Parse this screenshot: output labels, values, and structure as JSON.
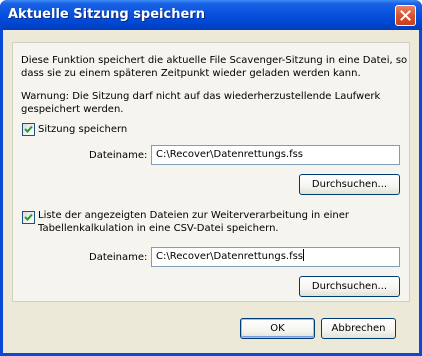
{
  "window": {
    "title": "Aktuelle Sitzung speichern"
  },
  "description": [
    "Diese Funktion speichert die aktuelle File Scavenger-Sitzung in eine Datei, so",
    "dass sie zu einem späteren Zeitpunkt wieder geladen werden kann."
  ],
  "warning": [
    "Warnung: Die Sitzung darf nicht auf das wiederherzustellende Laufwerk",
    "gespeichert werden."
  ],
  "session": {
    "checkbox_label": "Sitzung speichern",
    "checked": true,
    "filename_label": "Dateiname:",
    "filename_value": "C:\\Recover\\Datenrettungs.fss",
    "browse_label": "Durchsuchen..."
  },
  "csv": {
    "checkbox_label": [
      "Liste der angezeigten Dateien zur Weiterverarbeitung in einer",
      "Tabellenkalkulation in eine CSV-Datei speichern."
    ],
    "checked": true,
    "filename_label": "Dateiname:",
    "filename_value": "C:\\Recover\\Datenrettungs.fss",
    "browse_label": "Durchsuchen..."
  },
  "buttons": {
    "ok": "OK",
    "cancel": "Abbrechen"
  }
}
